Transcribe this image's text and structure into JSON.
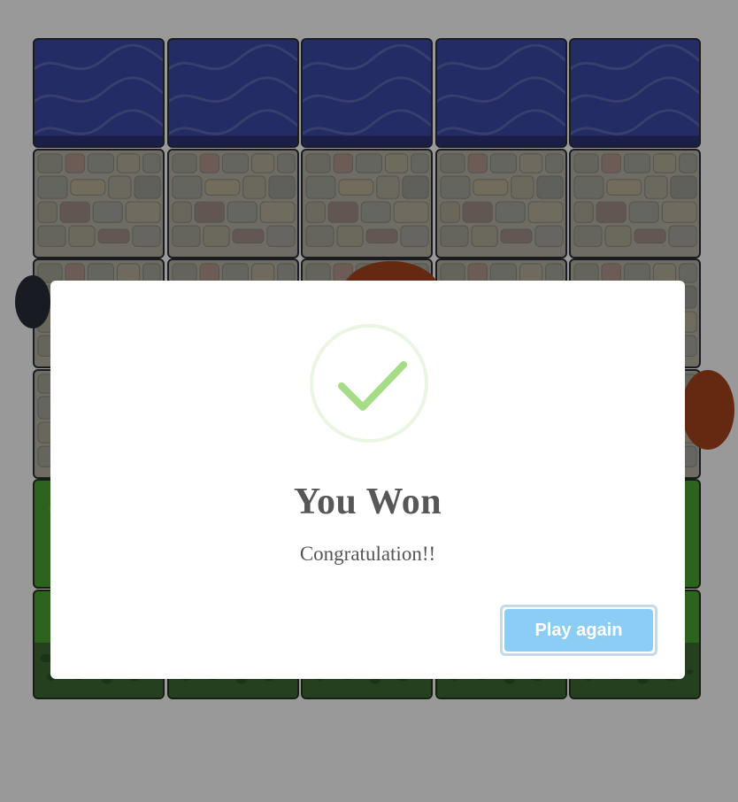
{
  "board": {
    "columns": 5,
    "rows": [
      "water",
      "stone",
      "stone",
      "stone",
      "grass",
      "grass-bottom"
    ]
  },
  "dialog": {
    "icon": "success-check-icon",
    "title": "You Won",
    "message": "Congratulation!!",
    "button_label": "Play again"
  },
  "colors": {
    "overlay": "#000000",
    "check": "#a5dc86",
    "check_ring": "#eaf6e4",
    "button": "#8ccdf5",
    "title_text": "#575757"
  }
}
